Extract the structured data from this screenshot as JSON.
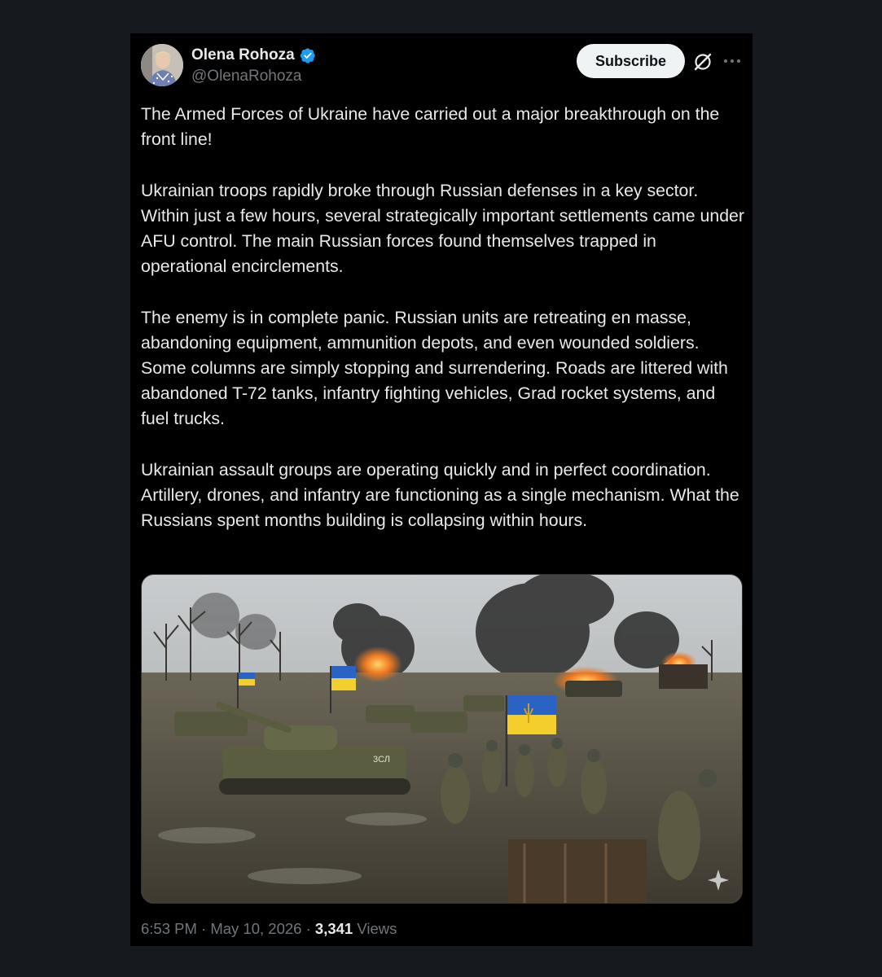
{
  "author": {
    "name": "Olena Rohoza",
    "handle": "@OlenaRohoza",
    "verified": true
  },
  "actions": {
    "subscribe_label": "Subscribe",
    "grok_icon": "grok-icon",
    "more_icon": "more-icon"
  },
  "post": {
    "paragraphs": [
      "The Armed Forces of Ukraine have carried out a major breakthrough on the front line!",
      "Ukrainian troops rapidly broke through Russian defenses in a key sector. Within just a few hours, several strategically important settlements came under AFU control. The main Russian forces found themselves trapped in operational encirclements.",
      "The enemy is in complete panic. Russian units are retreating en masse, abandoning equipment, ammunition depots, and even wounded soldiers. Some columns are simply stopping and surrendering. Roads are littered with abandoned T-72 tanks, infantry fighting vehicles, Grad rocket systems, and fuel trucks.",
      "Ukrainian assault groups are operating quickly and in perfect coordination. Artillery, drones, and infantry are functioning as a single mechanism. What the Russians spent months building is collapsing within hours."
    ],
    "media": {
      "tank_marking": "3СЛ"
    }
  },
  "meta": {
    "time": "6:53 PM",
    "separator": "·",
    "date": "May 10, 2026",
    "views_count": "3,341",
    "views_label": "Views"
  },
  "colors": {
    "page_bg": "#15181c",
    "card_bg": "#000000",
    "verified": "#1d9bf0",
    "secondary_text": "#71767b"
  }
}
